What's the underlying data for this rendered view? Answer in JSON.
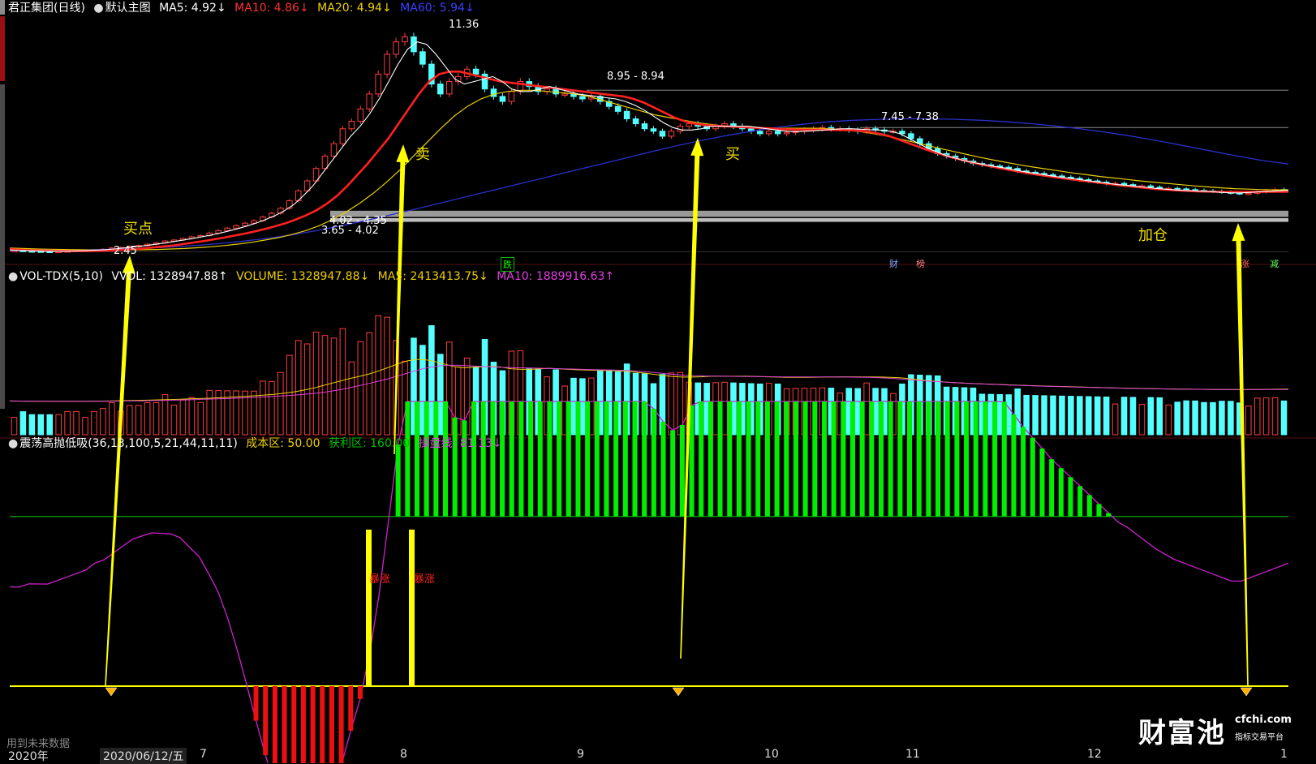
{
  "header": {
    "stock": "君正集团(日线)",
    "chart_name": "默认主图",
    "ma5": "MA5: 4.92↓",
    "ma10": "MA10: 4.86↓",
    "ma20": "MA20: 4.94↓",
    "ma60": "MA60: 5.94↓"
  },
  "volume_header": {
    "title": "VOL-TDX(5,10)",
    "vvol": "VVOL: 1328947.88↑",
    "volume": "VOLUME: 1328947.88↓",
    "ma5": "MA5: 2413413.75↓",
    "ma10": "MA10: 1889916.63↑"
  },
  "indicator_header": {
    "title": "震荡高抛低吸(36,13,100,5,21,44,11,11)",
    "cost": "成本区: 50.00",
    "profit": "获利区: 160.00",
    "line": "操盘线: 81.13↓"
  },
  "annotations": {
    "buy_point": "买点",
    "sell": "卖",
    "buy": "买",
    "add": "加仓",
    "high": "11.36",
    "low": "2.45",
    "range1": "8.95 - 8.94",
    "range2": "7.45 - 7.38",
    "range3": "4.02 - 4.35",
    "range4": "3.65 - 4.02",
    "surge1": "暴涨",
    "surge2": "暴涨",
    "future": "用到未来数据",
    "m_die": "跌",
    "m_cai": "财",
    "m_bang": "榜",
    "m_zhang": "涨",
    "m_jian": "减"
  },
  "xaxis": {
    "year": "2020年",
    "cursor_date": "2020/06/12/五",
    "m7": "7",
    "m8": "8",
    "m9": "9",
    "m10": "10",
    "m11": "11",
    "m12": "12",
    "m1": "1"
  },
  "logo": {
    "main": "财富池",
    "domain": "cfchi.com",
    "sub": "指标交易平台"
  },
  "colors": {
    "up": "#ff3c3c",
    "down": "#54ffff",
    "ma5": "#ffffff",
    "ma10": "#ff2020",
    "ma20": "#e8d000",
    "ma60": "#2a30c8",
    "arrow": "#ffff00",
    "osc": "#d020d0",
    "green_bar": "#00ee00",
    "red_bar": "#ee1010",
    "purple": "#e040e0"
  },
  "chart_data": [
    {
      "type": "candlestick",
      "title": "君正集团(日线)",
      "y_unit": "price",
      "ylim": [
        2.2,
        11.8
      ],
      "x_labels": [
        "7",
        "8",
        "9",
        "10",
        "11",
        "12",
        "1"
      ],
      "close": [
        2.5,
        2.48,
        2.47,
        2.46,
        2.45,
        2.46,
        2.48,
        2.5,
        2.5,
        2.52,
        2.55,
        2.6,
        2.62,
        2.66,
        2.7,
        2.75,
        2.8,
        2.88,
        2.92,
        2.98,
        3.05,
        3.1,
        3.2,
        3.3,
        3.4,
        3.5,
        3.6,
        3.7,
        3.85,
        4.0,
        4.2,
        4.5,
        4.9,
        5.3,
        5.8,
        6.3,
        6.8,
        7.4,
        7.7,
        8.2,
        8.8,
        9.6,
        10.4,
        10.9,
        11.1,
        10.5,
        10.0,
        9.2,
        8.8,
        9.3,
        9.5,
        9.8,
        9.6,
        9.0,
        8.7,
        8.5,
        8.9,
        9.3,
        9.1,
        8.9,
        9.0,
        8.8,
        8.8,
        8.7,
        8.6,
        8.7,
        8.5,
        8.3,
        8.1,
        7.8,
        7.6,
        7.4,
        7.3,
        7.1,
        7.3,
        7.5,
        7.6,
        7.5,
        7.4,
        7.5,
        7.6,
        7.5,
        7.4,
        7.3,
        7.2,
        7.3,
        7.2,
        7.25,
        7.3,
        7.35,
        7.4,
        7.45,
        7.4,
        7.4,
        7.35,
        7.3,
        7.4,
        7.35,
        7.3,
        7.3,
        7.2,
        7.0,
        6.8,
        6.6,
        6.4,
        6.3,
        6.2,
        6.1,
        6.0,
        5.95,
        5.9,
        5.85,
        5.8,
        5.7,
        5.65,
        5.6,
        5.55,
        5.5,
        5.45,
        5.4,
        5.35,
        5.3,
        5.25,
        5.2,
        5.2,
        5.15,
        5.1,
        5.1,
        5.05,
        5.0,
        5.0,
        4.98,
        4.95,
        4.92,
        4.9,
        4.88,
        4.85,
        4.82,
        4.8,
        4.8,
        4.85,
        4.9,
        4.95,
        4.92
      ],
      "ma5": [
        2.52,
        2.5,
        2.49,
        2.48,
        2.47,
        2.47,
        2.47,
        2.48,
        2.49,
        2.51,
        2.53,
        2.56,
        2.6,
        2.64,
        2.68,
        2.73,
        2.78,
        2.84,
        2.9,
        2.96,
        3.03,
        3.1,
        3.18,
        3.27,
        3.37,
        3.48,
        3.6,
        3.74,
        3.9,
        4.1,
        4.35,
        4.7,
        5.1,
        5.6,
        6.1,
        6.6,
        7.1,
        7.5,
        8.0,
        8.6,
        9.3,
        10.0,
        10.6,
        10.9,
        10.8,
        10.4,
        9.9,
        9.4,
        9.2,
        9.3,
        9.4,
        9.5,
        9.3,
        9.0,
        8.9,
        8.9,
        9.0,
        9.1,
        9.0,
        8.9,
        8.8,
        8.75,
        8.7,
        8.65,
        8.6,
        8.5,
        8.35,
        8.15,
        7.9,
        7.65,
        7.45,
        7.35,
        7.35,
        7.4,
        7.5,
        7.5,
        7.5,
        7.5,
        7.5,
        7.45,
        7.4,
        7.35,
        7.3,
        7.28,
        7.3,
        7.32,
        7.35,
        7.38,
        7.4,
        7.4,
        7.38,
        7.36,
        7.34,
        7.3,
        7.2,
        7.0,
        6.8,
        6.6,
        6.45,
        6.3,
        6.2,
        6.1,
        6.02,
        5.95,
        5.88,
        5.82,
        5.75,
        5.68,
        5.62,
        5.56,
        5.5,
        5.45,
        5.4,
        5.35,
        5.3,
        5.25,
        5.2,
        5.15,
        5.12,
        5.08,
        5.04,
        5.0,
        4.97,
        4.94,
        4.92,
        4.9,
        4.88,
        4.86,
        4.84,
        4.82,
        4.82,
        4.84,
        4.86,
        4.88,
        4.9,
        4.92
      ],
      "ma10": [
        2.55,
        2.53,
        2.51,
        2.5,
        2.49,
        2.48,
        2.48,
        2.48,
        2.48,
        2.49,
        2.5,
        2.52,
        2.55,
        2.58,
        2.62,
        2.66,
        2.7,
        2.76,
        2.82,
        2.88,
        2.95,
        3.02,
        3.1,
        3.18,
        3.27,
        3.37,
        3.48,
        3.6,
        3.75,
        3.92,
        4.12,
        4.38,
        4.7,
        5.1,
        5.55,
        6.0,
        6.5,
        7.0,
        7.6,
        8.2,
        8.8,
        9.3,
        9.6,
        9.7,
        9.7,
        9.6,
        9.5,
        9.4,
        9.3,
        9.25,
        9.2,
        9.15,
        9.1,
        9.05,
        9.0,
        8.95,
        8.9,
        8.85,
        8.8,
        8.75,
        8.7,
        8.6,
        8.45,
        8.25,
        8.05,
        7.85,
        7.7,
        7.6,
        7.55,
        7.52,
        7.5,
        7.48,
        7.46,
        7.44,
        7.42,
        7.4,
        7.38,
        7.37,
        7.36,
        7.36,
        7.36,
        7.35,
        7.34,
        7.32,
        7.28,
        7.2,
        7.1,
        6.95,
        6.8,
        6.65,
        6.5,
        6.38,
        6.26,
        6.15,
        6.05,
        5.96,
        5.88,
        5.8,
        5.72,
        5.65,
        5.58,
        5.52,
        5.46,
        5.4,
        5.35,
        5.3,
        5.25,
        5.2,
        5.15,
        5.1,
        5.06,
        5.02,
        4.98,
        4.95,
        4.92,
        4.9,
        4.88,
        4.87,
        4.86,
        4.86,
        4.86,
        4.86,
        4.86,
        4.86,
        4.86,
        4.86
      ],
      "ma20": [
        2.6,
        2.58,
        2.56,
        2.55,
        2.54,
        2.53,
        2.52,
        2.52,
        2.52,
        2.52,
        2.53,
        2.54,
        2.56,
        2.58,
        2.61,
        2.65,
        2.7,
        2.76,
        2.83,
        2.92,
        3.02,
        3.15,
        3.3,
        3.5,
        3.75,
        4.05,
        4.4,
        4.8,
        5.25,
        5.75,
        6.3,
        6.85,
        7.4,
        7.9,
        8.3,
        8.6,
        8.8,
        8.9,
        8.95,
        8.95,
        8.9,
        8.85,
        8.8,
        8.7,
        8.55,
        8.4,
        8.25,
        8.1,
        7.95,
        7.85,
        7.75,
        7.65,
        7.58,
        7.52,
        7.48,
        7.45,
        7.43,
        7.42,
        7.42,
        7.42,
        7.42,
        7.4,
        7.36,
        7.3,
        7.22,
        7.12,
        7.0,
        6.88,
        6.75,
        6.62,
        6.5,
        6.38,
        6.26,
        6.15,
        6.05,
        5.95,
        5.86,
        5.78,
        5.7,
        5.62,
        5.55,
        5.48,
        5.42,
        5.36,
        5.3,
        5.25,
        5.2,
        5.15,
        5.1,
        5.06,
        5.02,
        4.99,
        4.97,
        4.95,
        4.94,
        4.94
      ],
      "ma60": [
        2.5,
        2.51,
        2.52,
        2.53,
        2.55,
        2.58,
        2.62,
        2.68,
        2.76,
        2.86,
        2.98,
        3.12,
        3.3,
        3.5,
        3.72,
        3.96,
        4.2,
        4.45,
        4.7,
        4.95,
        5.2,
        5.45,
        5.7,
        5.95,
        6.2,
        6.45,
        6.7,
        6.92,
        7.12,
        7.3,
        7.45,
        7.58,
        7.68,
        7.74,
        7.78,
        7.8,
        7.8,
        7.78,
        7.74,
        7.68,
        7.6,
        7.5,
        7.38,
        7.24,
        7.08,
        6.9,
        6.7,
        6.5,
        6.3,
        6.12,
        5.98
      ]
    },
    {
      "type": "bar",
      "title": "VOL-TDX(5,10)",
      "values_note": "volume bars",
      "vvol": 1328947.88,
      "ma5": 2413413.75,
      "ma10": 1889916.63
    },
    {
      "type": "line",
      "title": "震荡高抛低吸(36,13,100,5,21,44,11,11)",
      "cost_zone": 50.0,
      "profit_zone": 160.0,
      "operation_line": 81.13
    }
  ]
}
